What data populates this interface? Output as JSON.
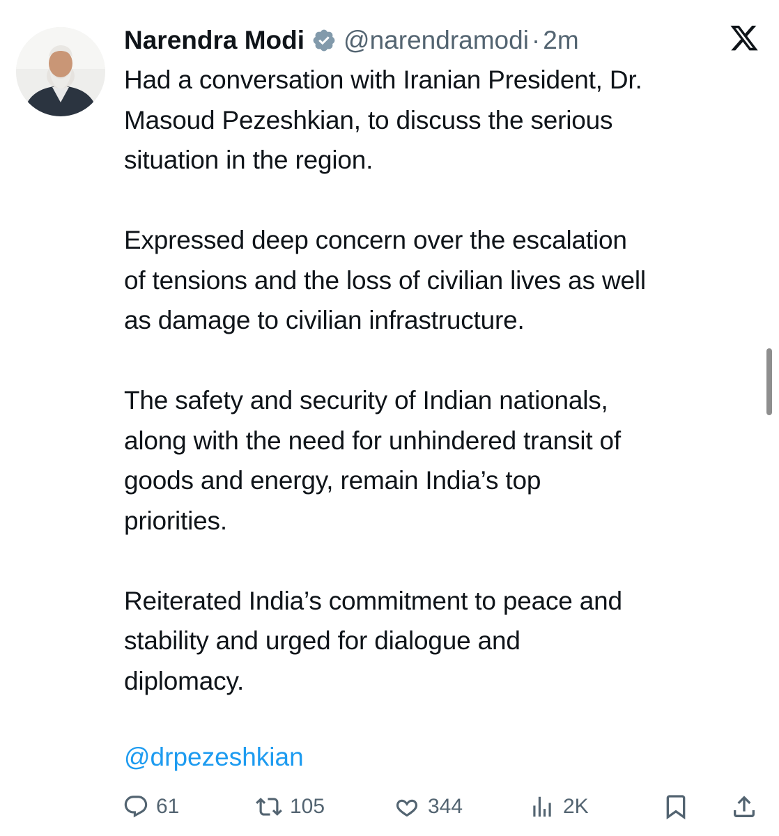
{
  "author": {
    "display_name": "Narendra Modi",
    "handle": "@narendramodi",
    "separator": "·",
    "time": "2m"
  },
  "tweet": {
    "paragraphs": [
      [
        "Had a conversation with Iranian President, Dr.",
        "Masoud Pezeshkian, to discuss the serious",
        "situation in the region."
      ],
      [
        "Expressed deep concern over the escalation",
        "of tensions and the loss of civilian lives as well",
        "as damage to civilian infrastructure."
      ],
      [
        "The safety and security of Indian nationals,",
        "along with the need for unhindered transit of",
        "goods and energy, remain India’s top",
        "priorities."
      ],
      [
        "Reiterated India’s commitment to peace and",
        "stability and urged for dialogue and",
        "diplomacy."
      ]
    ],
    "mention": "@drpezeshkian"
  },
  "actions": {
    "replies": "61",
    "reposts": "105",
    "likes": "344",
    "views": "2K"
  },
  "icons": {
    "avatar": "avatar",
    "verified": "verified-badge-icon",
    "platform": "x-logo-icon",
    "reply": "reply-icon",
    "repost": "repost-icon",
    "like": "heart-icon",
    "views": "views-icon",
    "bookmark": "bookmark-icon",
    "share": "share-icon"
  },
  "colors": {
    "text": "#0f1419",
    "secondary": "#536471",
    "link": "#1d9bf0"
  }
}
